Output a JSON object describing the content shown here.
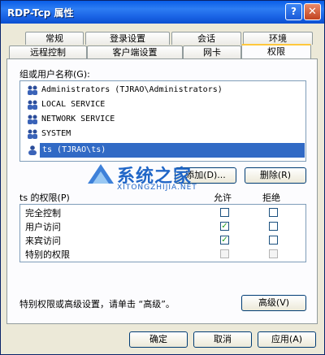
{
  "window": {
    "title": "RDP-Tcp 属性",
    "help_glyph": "?",
    "close_glyph": "✕"
  },
  "tabs_row1": [
    {
      "label": "常规"
    },
    {
      "label": "登录设置"
    },
    {
      "label": "会话"
    },
    {
      "label": "环境"
    }
  ],
  "tabs_row2": [
    {
      "label": "远程控制"
    },
    {
      "label": "客户端设置"
    },
    {
      "label": "网卡"
    },
    {
      "label": "权限",
      "active": true
    }
  ],
  "groups": {
    "label": "组或用户名称(G):",
    "items": [
      {
        "name": "Administrators (TJRAO\\Administrators)"
      },
      {
        "name": "LOCAL SERVICE"
      },
      {
        "name": "NETWORK SERVICE"
      },
      {
        "name": "SYSTEM"
      },
      {
        "name": "ts (TJRAO\\ts)",
        "selected": true
      }
    ]
  },
  "buttons": {
    "add": "添加(D)...",
    "remove": "删除(R)"
  },
  "permissions": {
    "label": "ts 的权限(P)",
    "col_allow": "允许",
    "col_deny": "拒绝",
    "rows": [
      {
        "name": "完全控制",
        "allow": false,
        "deny": false,
        "disabled": false
      },
      {
        "name": "用户访问",
        "allow": true,
        "deny": false,
        "disabled": false
      },
      {
        "name": "来宾访问",
        "allow": true,
        "deny": false,
        "disabled": false
      },
      {
        "name": "特别的权限",
        "allow": false,
        "deny": false,
        "disabled": true
      }
    ]
  },
  "advanced": {
    "text": "特别权限或高级设置，请单击 “高级”。",
    "button": "高级(V)"
  },
  "footer": {
    "ok": "确定",
    "cancel": "取消",
    "apply": "应用(A)"
  },
  "watermark": {
    "title": "系统之家",
    "subtitle": "XITONGZHIJIA.NET"
  }
}
